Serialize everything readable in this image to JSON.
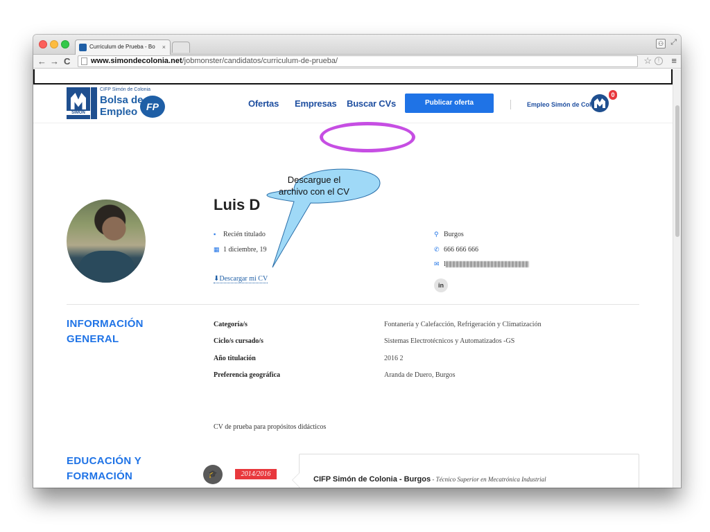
{
  "browser": {
    "tab_title": "Curriculum de Prueba - Bo",
    "tab_close": "×",
    "url_host": "www.simondecolonia.net",
    "url_path": "/jobmonster/candidatos/curriculum-de-prueba/",
    "back": "←",
    "forward": "→",
    "reload": "C",
    "star": "☆",
    "ext": "!",
    "menu": "≡"
  },
  "logo": {
    "small": "CIFP Simón de Colonia",
    "line1": "Bolsa de",
    "line2": "Empleo",
    "fp": "FP",
    "mark_text": "SIMON"
  },
  "nav": {
    "ofertas": "Ofertas",
    "empresas": "Empresas",
    "buscar_cvs": "Buscar CVs",
    "publicar": "Publicar oferta",
    "account": "Empleo Simón de Col...",
    "notifications": "0"
  },
  "callout": {
    "line1": "Descargue el",
    "line2": "archivo con el CV"
  },
  "profile": {
    "name": "Luis D",
    "status": "Recién titulado",
    "birth": "1 diciembre, 19",
    "download": "Descargar mi CV",
    "location": "Burgos",
    "phone": "666 666 666",
    "email_prefix": "l",
    "linkedin": "in"
  },
  "general": {
    "title_line1": "INFORMACIÓN",
    "title_line2": "GENERAL",
    "fields": [
      {
        "label": "Categoría/s",
        "value": "Fontanería y Calefacción, Refrigeración y Climatización"
      },
      {
        "label": "Ciclo/s cursado/s",
        "value": "Sistemas Electrotécnicos y Automatizados -GS"
      },
      {
        "label": "Año titulación",
        "value": "2016 2"
      },
      {
        "label": "Preferencia geográfica",
        "value": "Aranda de Duero, Burgos"
      }
    ],
    "description": "CV de prueba para propósitos didácticos"
  },
  "education": {
    "title_line1": "EDUCACIÓN Y",
    "title_line2": "FORMACIÓN",
    "date": "2014/2016",
    "school": "CIFP Simón de Colonia - Burgos",
    "separator": " - ",
    "degree": "Técnico Superior en Mecatrónica Industrial"
  },
  "colors": {
    "accent": "#1f73e6",
    "highlight_ring": "#c64ee3",
    "callout_fill": "#9fd9f7",
    "badge": "#e8383d"
  }
}
